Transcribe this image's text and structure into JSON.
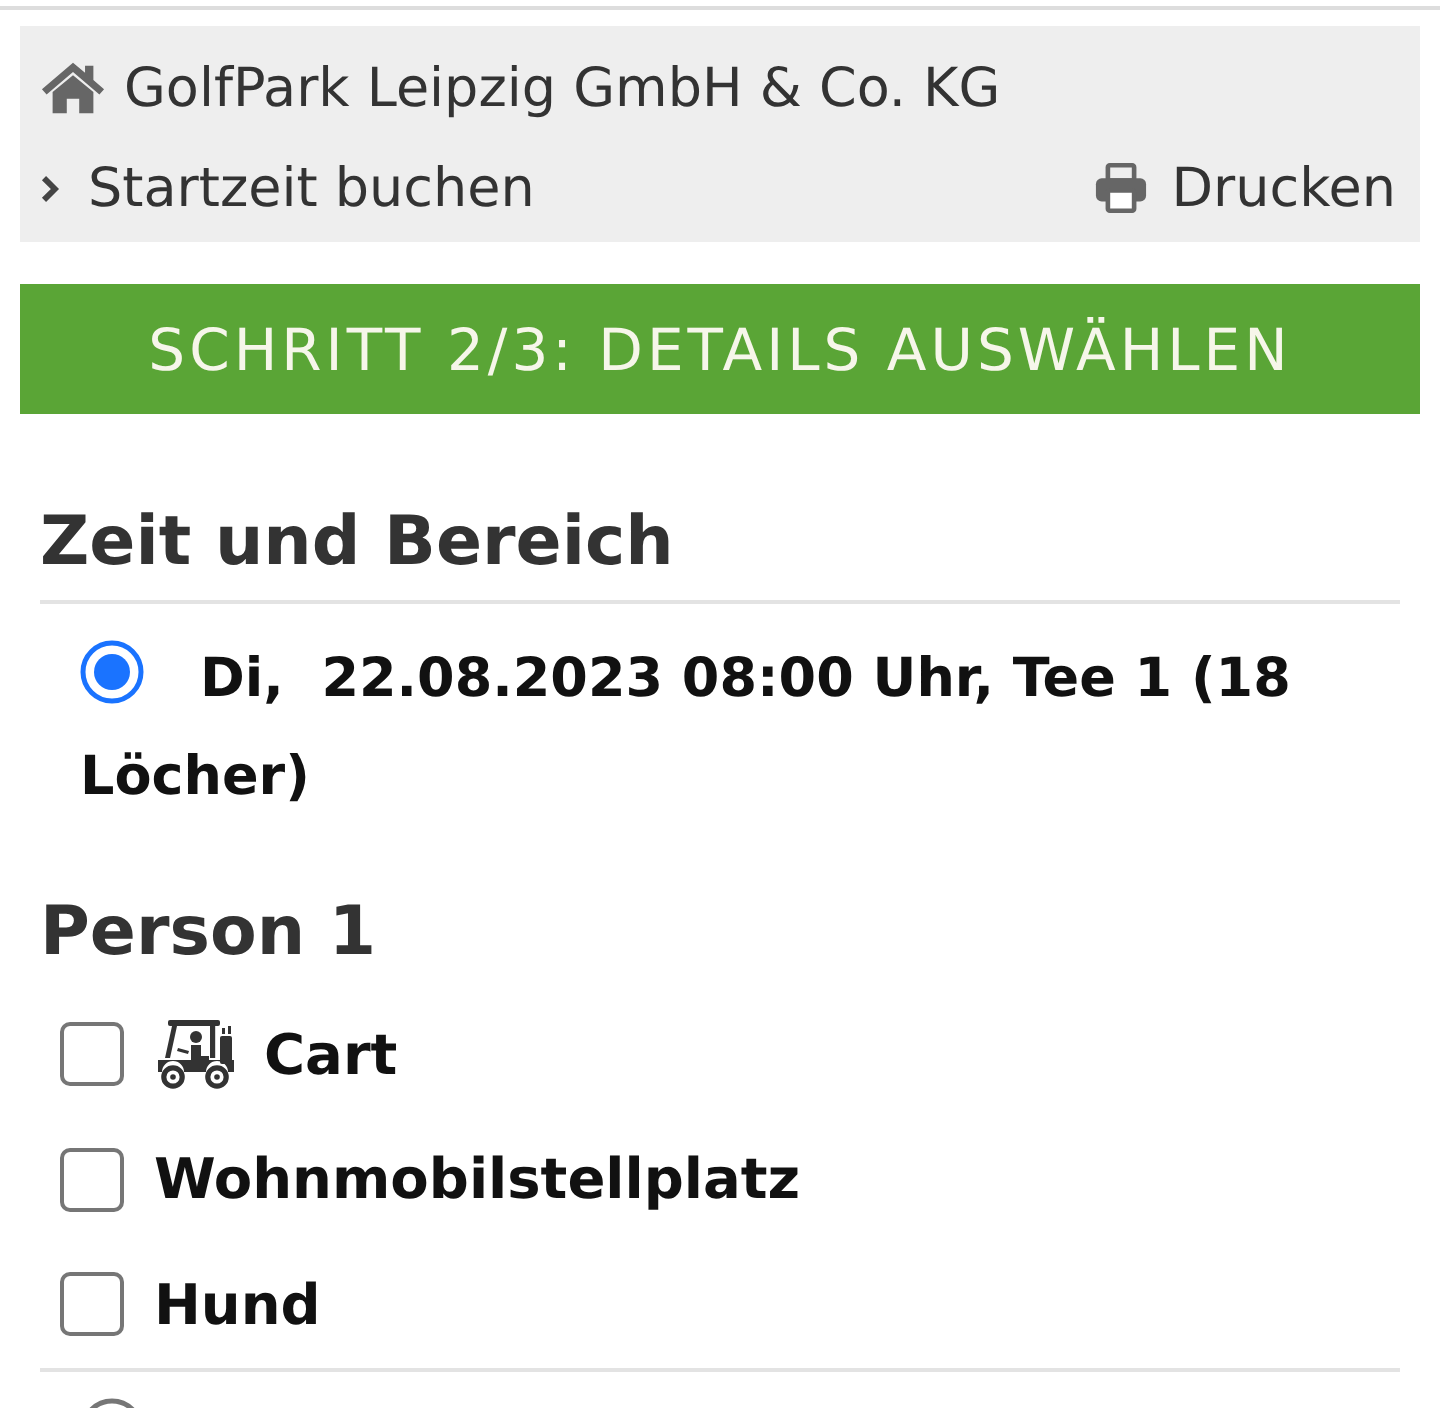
{
  "header": {
    "club_name": "GolfPark Leipzig GmbH & Co. KG",
    "breadcrumb": "Startzeit buchen",
    "print_link": "Drucken"
  },
  "step_banner": "SCHRITT 2/3: DETAILS AUSWÄHLEN",
  "time_section": {
    "heading": "Zeit und Bereich",
    "options": [
      {
        "label": "Di,  22.08.2023 08:00 Uhr, Tee 1 (18 Löcher)",
        "selected": true
      }
    ]
  },
  "person_section": {
    "heading": "Person 1",
    "extras": [
      {
        "label": "Cart",
        "kind": "cart",
        "checked": false
      },
      {
        "label": "Wohnmobilstellplatz",
        "kind": "plain",
        "checked": false
      },
      {
        "label": "Hund",
        "kind": "plain",
        "checked": false
      }
    ]
  },
  "next_section": {
    "options": [
      {
        "selected": false
      }
    ]
  }
}
